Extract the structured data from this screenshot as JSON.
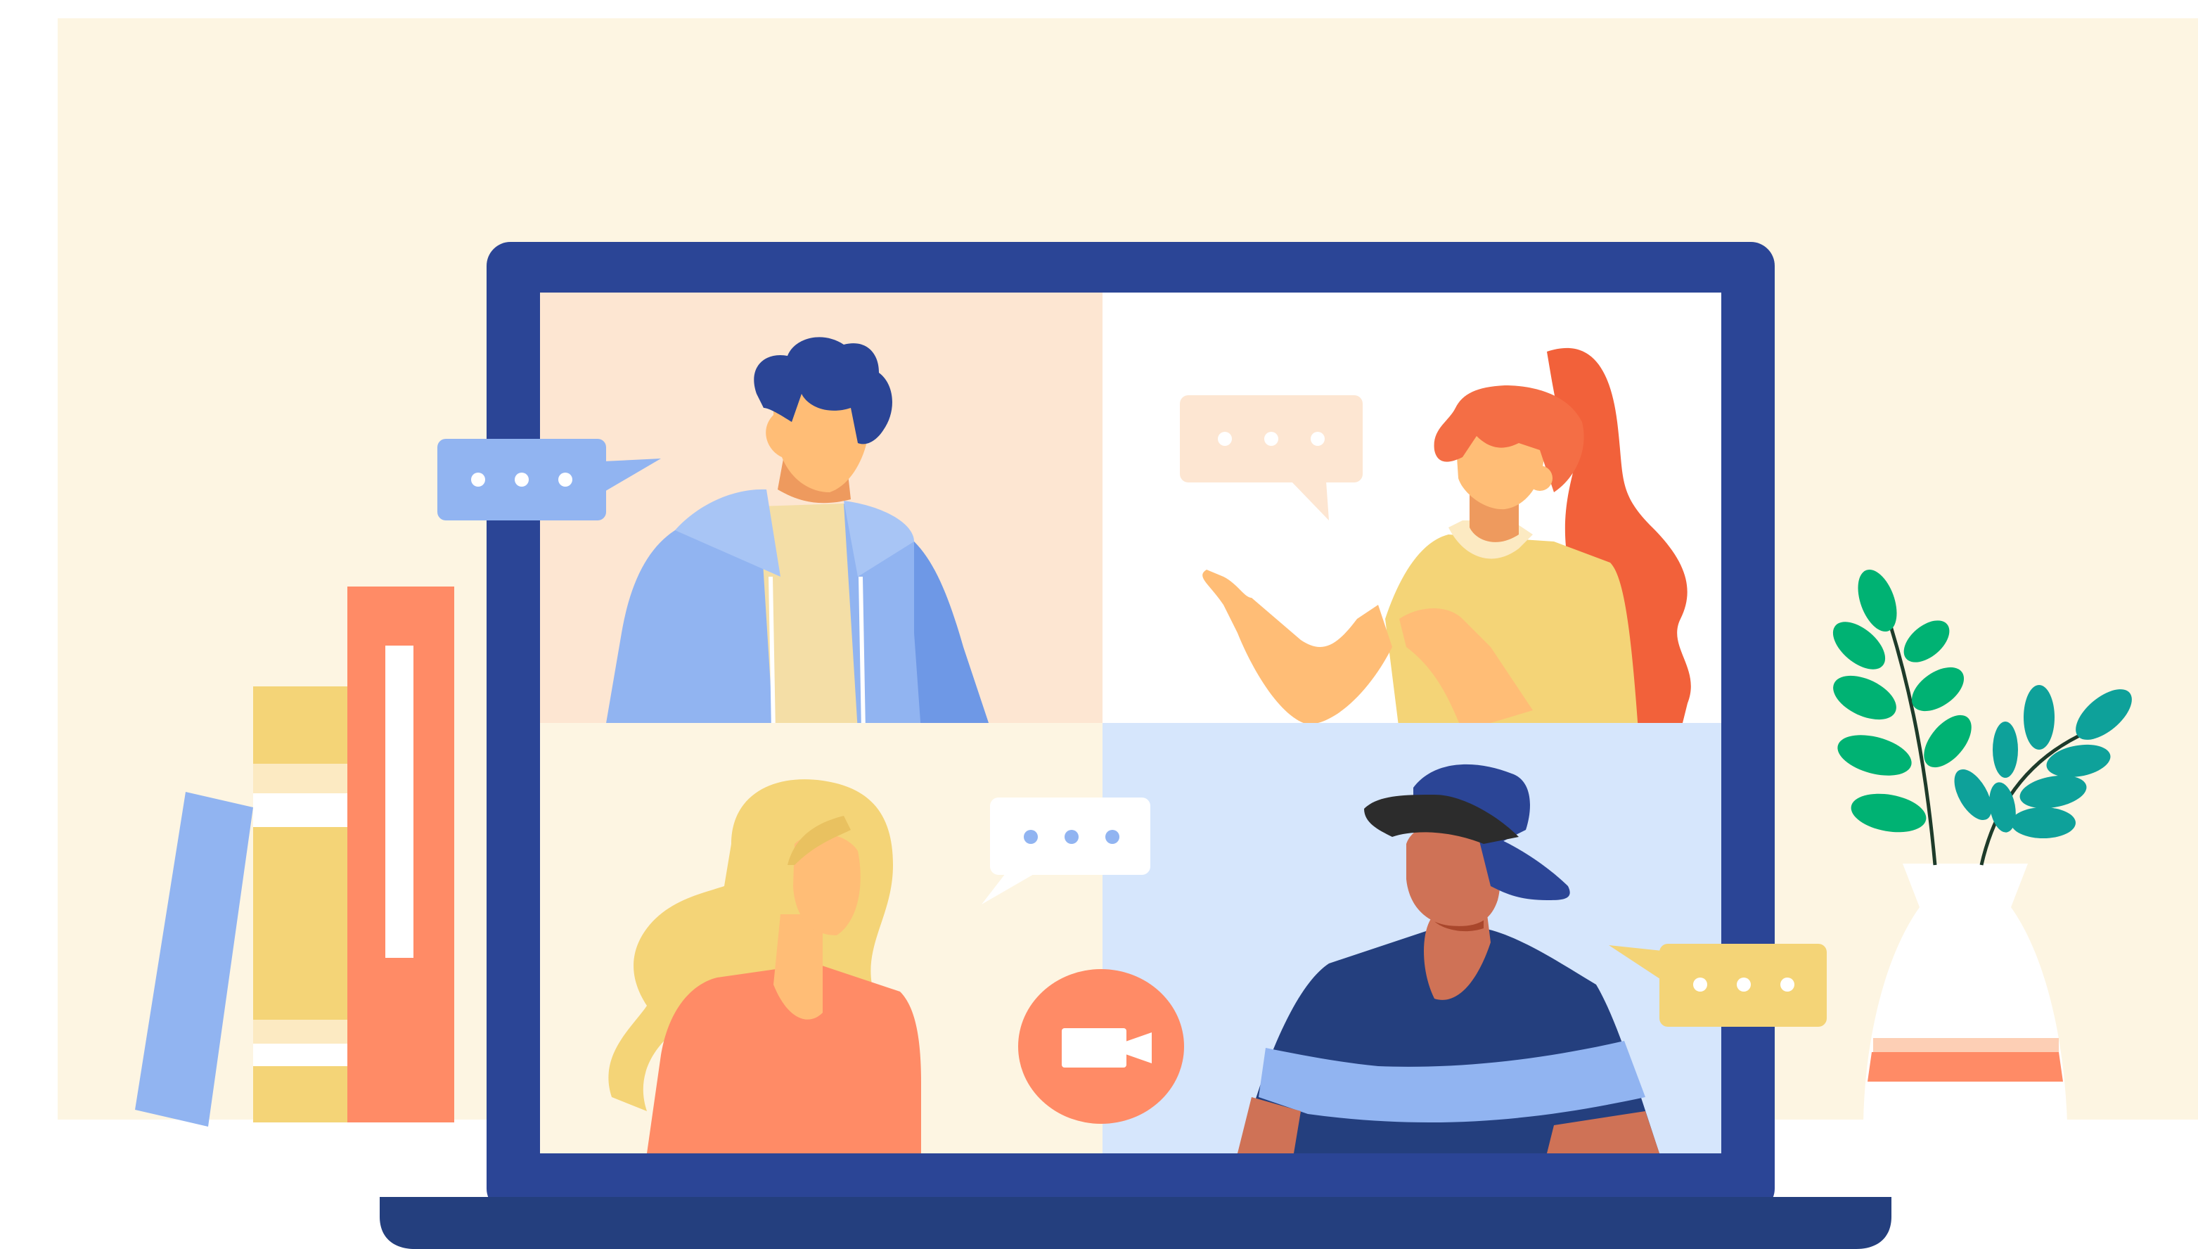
{
  "palette": {
    "wall": "#FDF5E2",
    "laptop": "#2B4596",
    "laptop_base": "#243F7E",
    "screen_peach": "#FDE6D2",
    "screen_white": "#FFFFFF",
    "screen_cream": "#FDF5E2",
    "screen_blue": "#D6E6FC",
    "blue_light": "#91B4F1",
    "orange": "#FF8B66",
    "yellow": "#F4D477",
    "skin": "#FFBD76",
    "skin_dark": "#CF7256",
    "red_hair": "#F2613A",
    "green": "#00B273",
    "teal": "#0EA19A",
    "video_button": "#FF8B66"
  },
  "icons": {
    "call_button": "video-camera-icon",
    "bubbles": "typing-dots-icon"
  }
}
